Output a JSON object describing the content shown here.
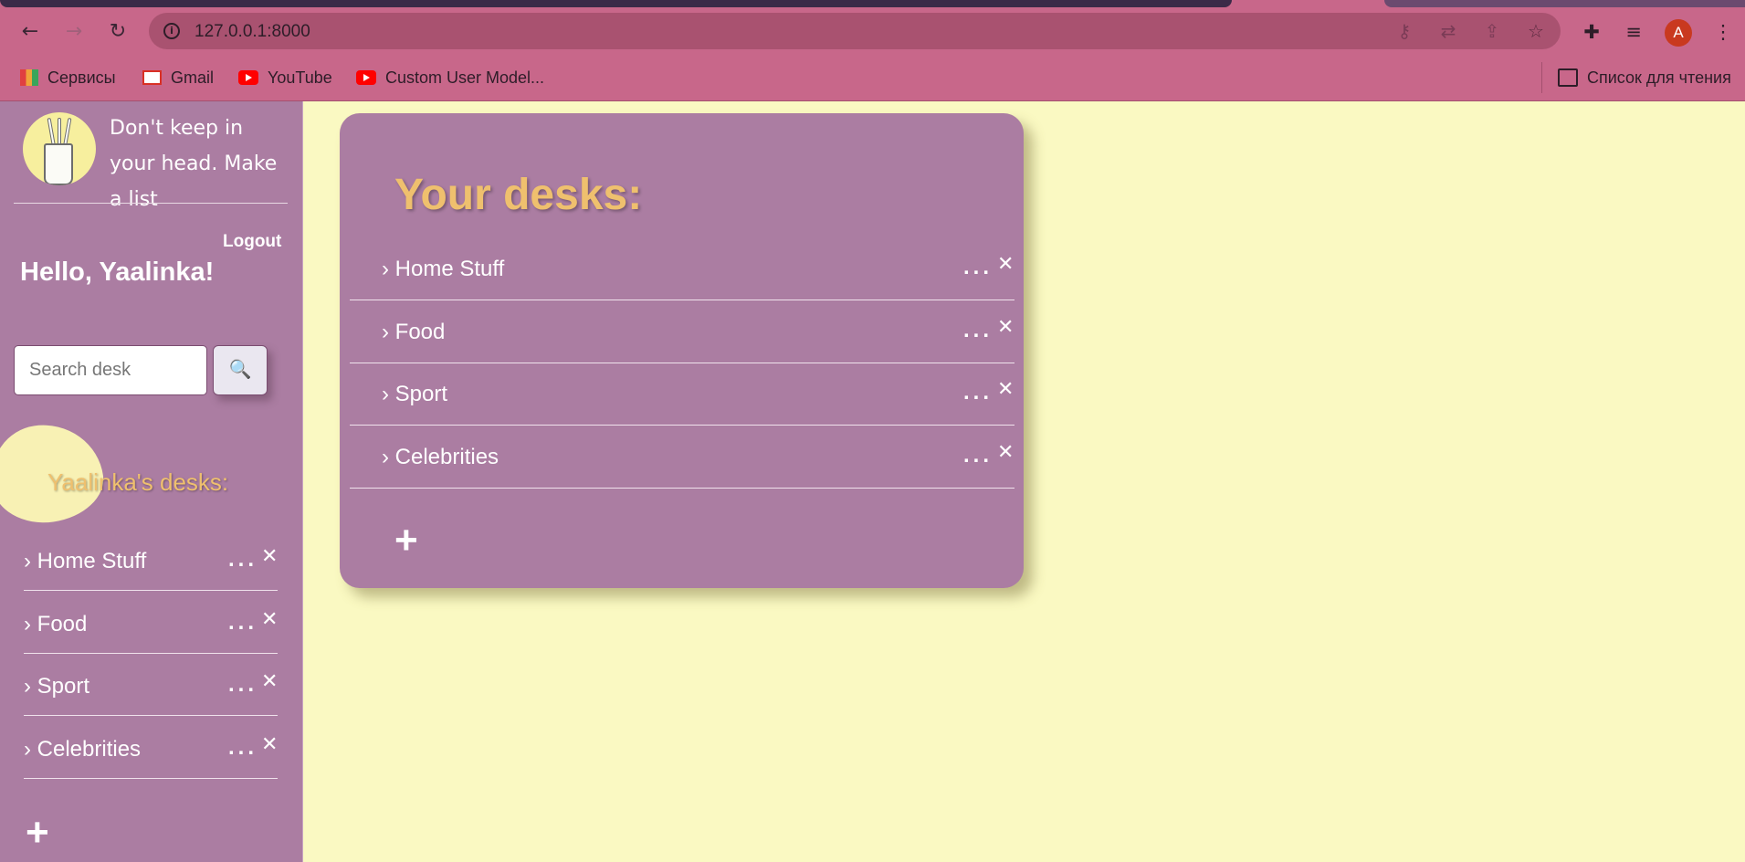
{
  "browser": {
    "url": "127.0.0.1:8000",
    "profile_initial": "A",
    "bookmarks": [
      {
        "label": "Сервисы",
        "icon": "apps-grid-icon"
      },
      {
        "label": "Gmail",
        "icon": "gmail-icon"
      },
      {
        "label": "YouTube",
        "icon": "youtube-icon"
      },
      {
        "label": "Custom User Model...",
        "icon": "youtube-icon"
      }
    ],
    "reading_list_label": "Список для чтения"
  },
  "sidebar": {
    "tagline": "Don't keep in your head. Make a list",
    "logout_label": "Logout",
    "greeting": "Hello, Yaalinka!",
    "search_placeholder": "Search desk",
    "search_button_icon": "🔍",
    "heading": "Yaalinka's desks:",
    "desks": [
      {
        "label": "› Home Stuff"
      },
      {
        "label": "› Food"
      },
      {
        "label": "› Sport"
      },
      {
        "label": "› Celebrities"
      }
    ],
    "add_label": "+"
  },
  "main": {
    "title": "Your desks:",
    "desks": [
      {
        "label": "› Home Stuff"
      },
      {
        "label": "› Food"
      },
      {
        "label": "› Sport"
      },
      {
        "label": "› Celebrities"
      }
    ],
    "dots_label": "...",
    "close_label": "✕",
    "add_label": "+"
  },
  "colors": {
    "page_bg": "#faf9c2",
    "panel": "#ab7da2",
    "accent": "#efc06e",
    "browser_chrome": "#c8678a"
  }
}
